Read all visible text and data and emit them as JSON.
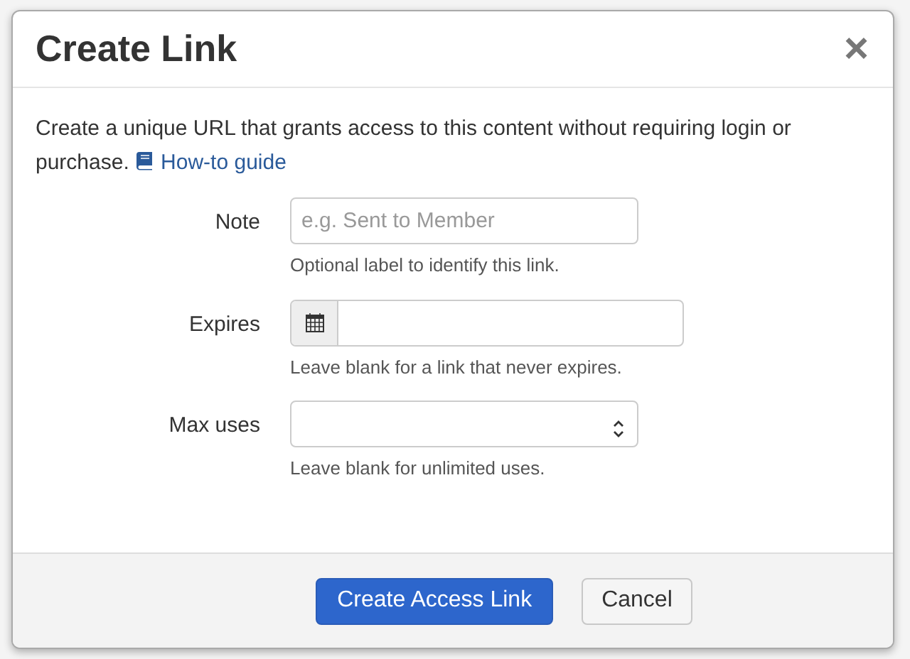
{
  "dialog": {
    "title": "Create Link",
    "close": "×"
  },
  "intro": {
    "text": "Create a unique URL that grants access to this content without requiring login or purchase.",
    "link": "How-to guide"
  },
  "fields": [
    {
      "kind": "text",
      "label": "Note",
      "placeholder": "e.g. Sent to Member",
      "help": "Optional label to identify this link."
    },
    {
      "kind": "date",
      "label": "Expires",
      "help": "Leave blank for a link that never expires."
    },
    {
      "kind": "number",
      "label": "Max uses",
      "help": "Leave blank for unlimited uses."
    }
  ],
  "buttons": [
    {
      "kind": "primary",
      "label": "Create Access Link"
    },
    {
      "kind": "secondary",
      "label": "Cancel"
    }
  ]
}
